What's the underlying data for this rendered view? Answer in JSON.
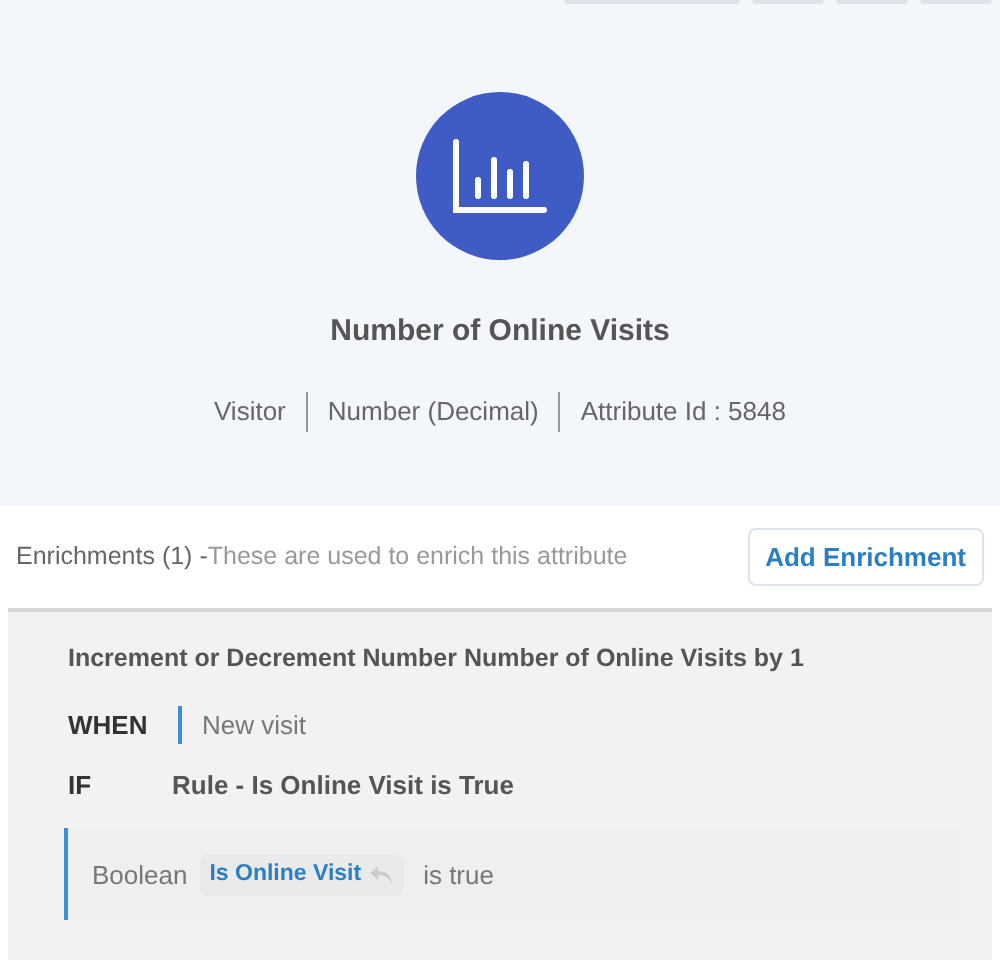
{
  "attribute": {
    "title": "Number of Online Visits",
    "meta": [
      "Visitor",
      "Number (Decimal)",
      "Attribute Id : 5848"
    ]
  },
  "enrichments": {
    "heading": "Enrichments (1) -",
    "description": "These are used to enrich this attribute",
    "add_button": "Add Enrichment",
    "items": [
      {
        "title": "Increment or Decrement Number Number of Online Visits by 1",
        "when_label": "WHEN",
        "when_value": "New visit",
        "if_label": "IF",
        "if_value": "Rule - Is Online Visit is True",
        "condition": {
          "type": "Boolean",
          "attribute": "Is Online Visit",
          "operator": "is true"
        }
      }
    ]
  }
}
